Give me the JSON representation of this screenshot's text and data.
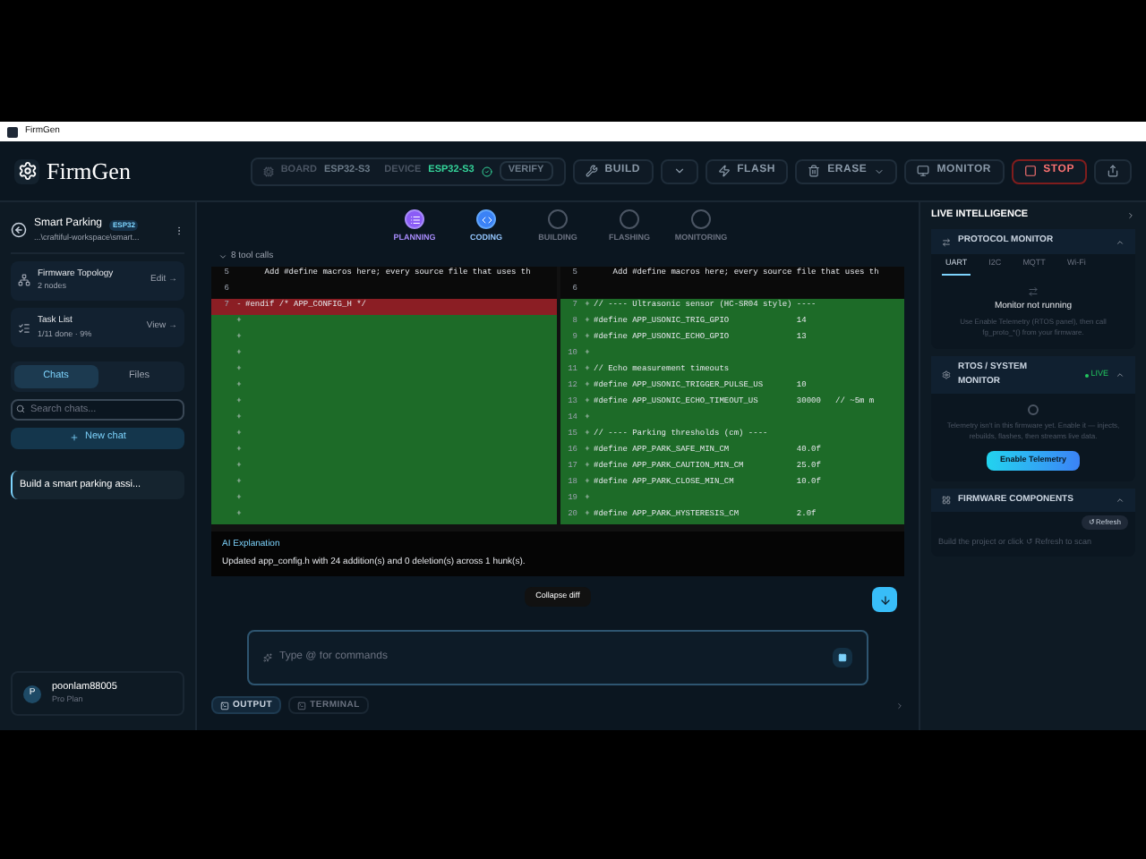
{
  "window": {
    "title": "FirmGen"
  },
  "header": {
    "logo": "FirmGen",
    "board_label": "BOARD",
    "board": "ESP32-S3",
    "device_label": "DEVICE",
    "device": "ESP32-S3",
    "buttons": [
      {
        "kind": "verify",
        "label": "VERIFY"
      },
      {
        "kind": "build",
        "label": "BUILD"
      },
      {
        "kind": "caret"
      },
      {
        "kind": "flash",
        "label": "FLASH"
      },
      {
        "kind": "erase",
        "label": "ERASE"
      },
      {
        "kind": "monitor",
        "label": "MONITOR"
      },
      {
        "kind": "stop",
        "label": "STOP"
      },
      {
        "kind": "share"
      }
    ]
  },
  "sidebar": {
    "project": {
      "name": "Smart Parking",
      "badge": "ESP32",
      "path": "...\\craftiful-workspace\\smart..."
    },
    "cards": [
      {
        "kind": "topology",
        "title": "Firmware Topology",
        "subtitle": "2 nodes",
        "action": "Edit →"
      },
      {
        "kind": "tasks",
        "title": "Task List",
        "subtitle": "1/11 done · 9%",
        "action": "View →"
      }
    ],
    "tabs": [
      {
        "label": "Chats",
        "selected": true
      },
      {
        "label": "Files",
        "selected": false
      }
    ],
    "search": {
      "placeholder": "Search chats..."
    },
    "new_chat": "New chat",
    "chats": [
      {
        "title": "Build a smart parking assi...",
        "selected": true
      }
    ],
    "user": {
      "initial": "P",
      "name": "poonlam88005",
      "plan": "Pro Plan"
    }
  },
  "steps": [
    {
      "label": "PLANNING",
      "done": true,
      "selected": false
    },
    {
      "label": "CODING",
      "done": false,
      "selected": true
    },
    {
      "label": "BUILDING",
      "done": false,
      "selected": false
    },
    {
      "label": "FLASHING",
      "done": false,
      "selected": false
    },
    {
      "label": "MONITORING",
      "done": false,
      "selected": false
    }
  ],
  "tool_calls": "8 tool calls",
  "diff": {
    "rows": [
      {
        "left": {
          "kind": "context",
          "number": "5",
          "text": "    Add #define macros here; every source file that uses th"
        },
        "right": {
          "kind": "context",
          "number": "5",
          "text": "    Add #define macros here; every source file that uses th"
        }
      },
      {
        "left": {
          "kind": "context",
          "number": "6"
        },
        "right": {
          "kind": "context",
          "number": "6"
        }
      },
      {
        "left": {
          "kind": "deleted",
          "number": "7",
          "sign": "-",
          "text": "#endif /* APP_CONFIG_H */"
        },
        "right": {
          "kind": "added",
          "number": "7",
          "sign": "+",
          "text": "// ---- Ultrasonic sensor (HC-SR04 style) ----"
        }
      },
      {
        "left": {
          "kind": "added",
          "sign": "+"
        },
        "right": {
          "kind": "added",
          "number": "8",
          "sign": "+",
          "text": "#define APP_USONIC_TRIG_GPIO              14"
        }
      },
      {
        "left": {
          "kind": "added",
          "sign": "+"
        },
        "right": {
          "kind": "added",
          "number": "9",
          "sign": "+",
          "text": "#define APP_USONIC_ECHO_GPIO              13"
        }
      },
      {
        "left": {
          "kind": "added",
          "sign": "+"
        },
        "right": {
          "kind": "added",
          "number": "10",
          "sign": "+"
        }
      },
      {
        "left": {
          "kind": "added",
          "sign": "+"
        },
        "right": {
          "kind": "added",
          "number": "11",
          "sign": "+",
          "text": "// Echo measurement timeouts"
        }
      },
      {
        "left": {
          "kind": "added",
          "sign": "+"
        },
        "right": {
          "kind": "added",
          "number": "12",
          "sign": "+",
          "text": "#define APP_USONIC_TRIGGER_PULSE_US       10"
        }
      },
      {
        "left": {
          "kind": "added",
          "sign": "+"
        },
        "right": {
          "kind": "added",
          "number": "13",
          "sign": "+",
          "text": "#define APP_USONIC_ECHO_TIMEOUT_US        30000   // ~5m m"
        }
      },
      {
        "left": {
          "kind": "added",
          "sign": "+"
        },
        "right": {
          "kind": "added",
          "number": "14",
          "sign": "+"
        }
      },
      {
        "left": {
          "kind": "added",
          "sign": "+"
        },
        "right": {
          "kind": "added",
          "number": "15",
          "sign": "+",
          "text": "// ---- Parking thresholds (cm) ----"
        }
      },
      {
        "left": {
          "kind": "added",
          "sign": "+"
        },
        "right": {
          "kind": "added",
          "number": "16",
          "sign": "+",
          "text": "#define APP_PARK_SAFE_MIN_CM              40.0f"
        }
      },
      {
        "left": {
          "kind": "added",
          "sign": "+"
        },
        "right": {
          "kind": "added",
          "number": "17",
          "sign": "+",
          "text": "#define APP_PARK_CAUTION_MIN_CM           25.0f"
        }
      },
      {
        "left": {
          "kind": "added",
          "sign": "+"
        },
        "right": {
          "kind": "added",
          "number": "18",
          "sign": "+",
          "text": "#define APP_PARK_CLOSE_MIN_CM             10.0f"
        }
      },
      {
        "left": {
          "kind": "added",
          "sign": "+"
        },
        "right": {
          "kind": "added",
          "number": "19",
          "sign": "+"
        }
      },
      {
        "left": {
          "kind": "added",
          "sign": "+"
        },
        "right": {
          "kind": "added",
          "number": "20",
          "sign": "+",
          "text": "#define APP_PARK_HYSTERESIS_CM            2.0f"
        }
      }
    ]
  },
  "explanation": {
    "title": "AI Explanation",
    "text": "Updated app_config.h with 24 addition(s) and 0 deletion(s) across 1 hunk(s)."
  },
  "collapse": "Collapse diff",
  "composer": {
    "placeholder": "Type @ for commands"
  },
  "bottom_tabs": [
    {
      "label": "OUTPUT",
      "selected": true
    },
    {
      "label": "TERMINAL",
      "selected": false
    }
  ],
  "right": {
    "title": "LIVE INTELLIGENCE",
    "protocol": {
      "title": "PROTOCOL MONITOR",
      "tabs": [
        {
          "label": "UART",
          "selected": true
        },
        {
          "label": "I2C",
          "selected": false
        },
        {
          "label": "MQTT",
          "selected": false
        },
        {
          "label": "Wi-Fi",
          "selected": false
        }
      ],
      "status": "Monitor not running",
      "hint": "Use Enable Telemetry (RTOS panel), then call fg_proto_*() from your firmware."
    },
    "rtos": {
      "title": "RTOS / SYSTEM MONITOR",
      "badge": "LIVE",
      "hint": "Telemetry isn't in this firmware yet. Enable it — injects, rebuilds, flashes, then streams live data.",
      "button": "Enable Telemetry"
    },
    "components": {
      "title": "FIRMWARE COMPONENTS",
      "refresh": "↺ Refresh",
      "hint": "Build the project or click ↺ Refresh to scan"
    }
  }
}
